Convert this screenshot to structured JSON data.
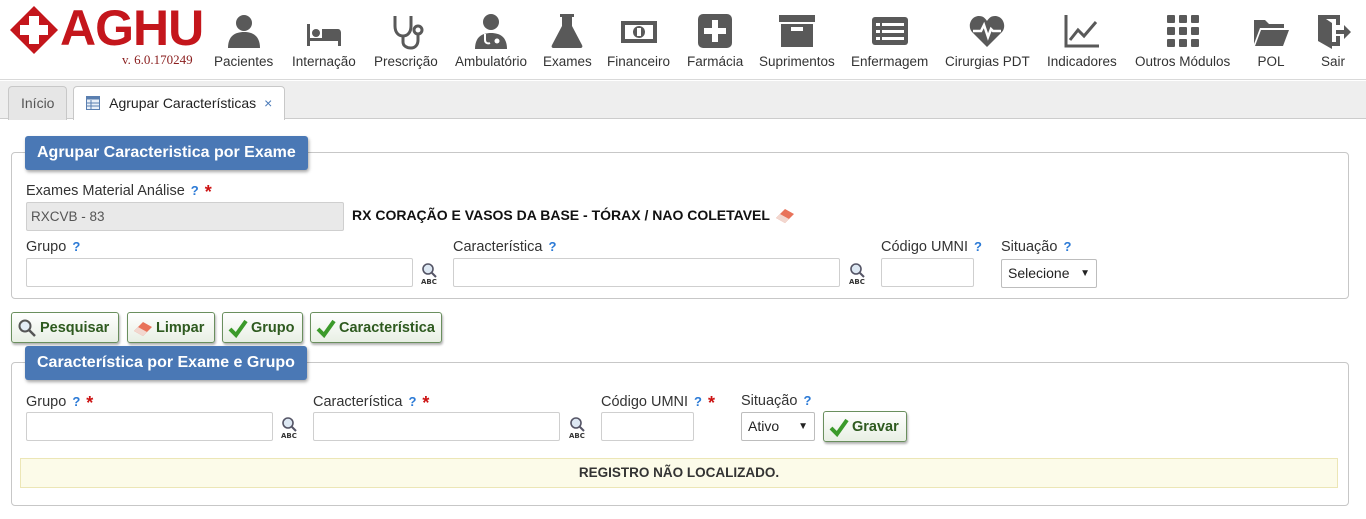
{
  "logo": {
    "text": "AGHU",
    "version": "v. 6.0.170249"
  },
  "nav": [
    {
      "label": "Pacientes",
      "icon": "user-icon"
    },
    {
      "label": "Internação",
      "icon": "bed-icon"
    },
    {
      "label": "Prescrição",
      "icon": "stethoscope-icon"
    },
    {
      "label": "Ambulatório",
      "icon": "doctor-icon"
    },
    {
      "label": "Exames",
      "icon": "flask-icon"
    },
    {
      "label": "Financeiro",
      "icon": "money-icon"
    },
    {
      "label": "Farmácia",
      "icon": "plus-square-icon"
    },
    {
      "label": "Suprimentos",
      "icon": "archive-icon"
    },
    {
      "label": "Enfermagem",
      "icon": "list-icon"
    },
    {
      "label": "Cirurgias PDT",
      "icon": "heartbeat-icon"
    },
    {
      "label": "Indicadores",
      "icon": "line-chart-icon"
    },
    {
      "label": "Outros Módulos",
      "icon": "grid-icon"
    },
    {
      "label": "POL",
      "icon": "folder-icon"
    },
    {
      "label": "Sair",
      "icon": "exit-icon"
    }
  ],
  "tabs": [
    {
      "label": "Início"
    },
    {
      "label": "Agrupar Características",
      "close": "×"
    }
  ],
  "search_panel": {
    "legend": "Agrupar Caracteristica por Exame",
    "exame_label": "Exames Material Análise",
    "help": "?",
    "required": "*",
    "exame_value": "RXCVB - 83",
    "exame_desc": "RX CORAÇÃO E VASOS DA BASE - TÓRAX / NAO COLETAVEL",
    "grupo_label": "Grupo",
    "grupo_value": "",
    "caracteristica_label": "Característica",
    "caracteristica_value": "",
    "codigo_label": "Código UMNI",
    "codigo_value": "",
    "situacao_label": "Situação",
    "situacao_value": "Selecione"
  },
  "actions": {
    "pesquisar": "Pesquisar",
    "limpar": "Limpar",
    "grupo": "Grupo",
    "caracteristica": "Característica"
  },
  "edit_panel": {
    "legend": "Característica por Exame e Grupo",
    "grupo_label": "Grupo",
    "grupo_value": "",
    "caracteristica_label": "Característica",
    "caracteristica_value": "",
    "codigo_label": "Código UMNI",
    "codigo_value": "",
    "situacao_label": "Situação",
    "situacao_value": "Ativo",
    "gravar": "Gravar",
    "notice": "REGISTRO NÃO LOCALIZADO."
  },
  "colors": {
    "brand_red": "#c4161c",
    "legend_blue": "#4a78b5",
    "help_blue": "#2b7ad6",
    "button_green": "#2e5a1f",
    "icon_gray": "#595959"
  }
}
